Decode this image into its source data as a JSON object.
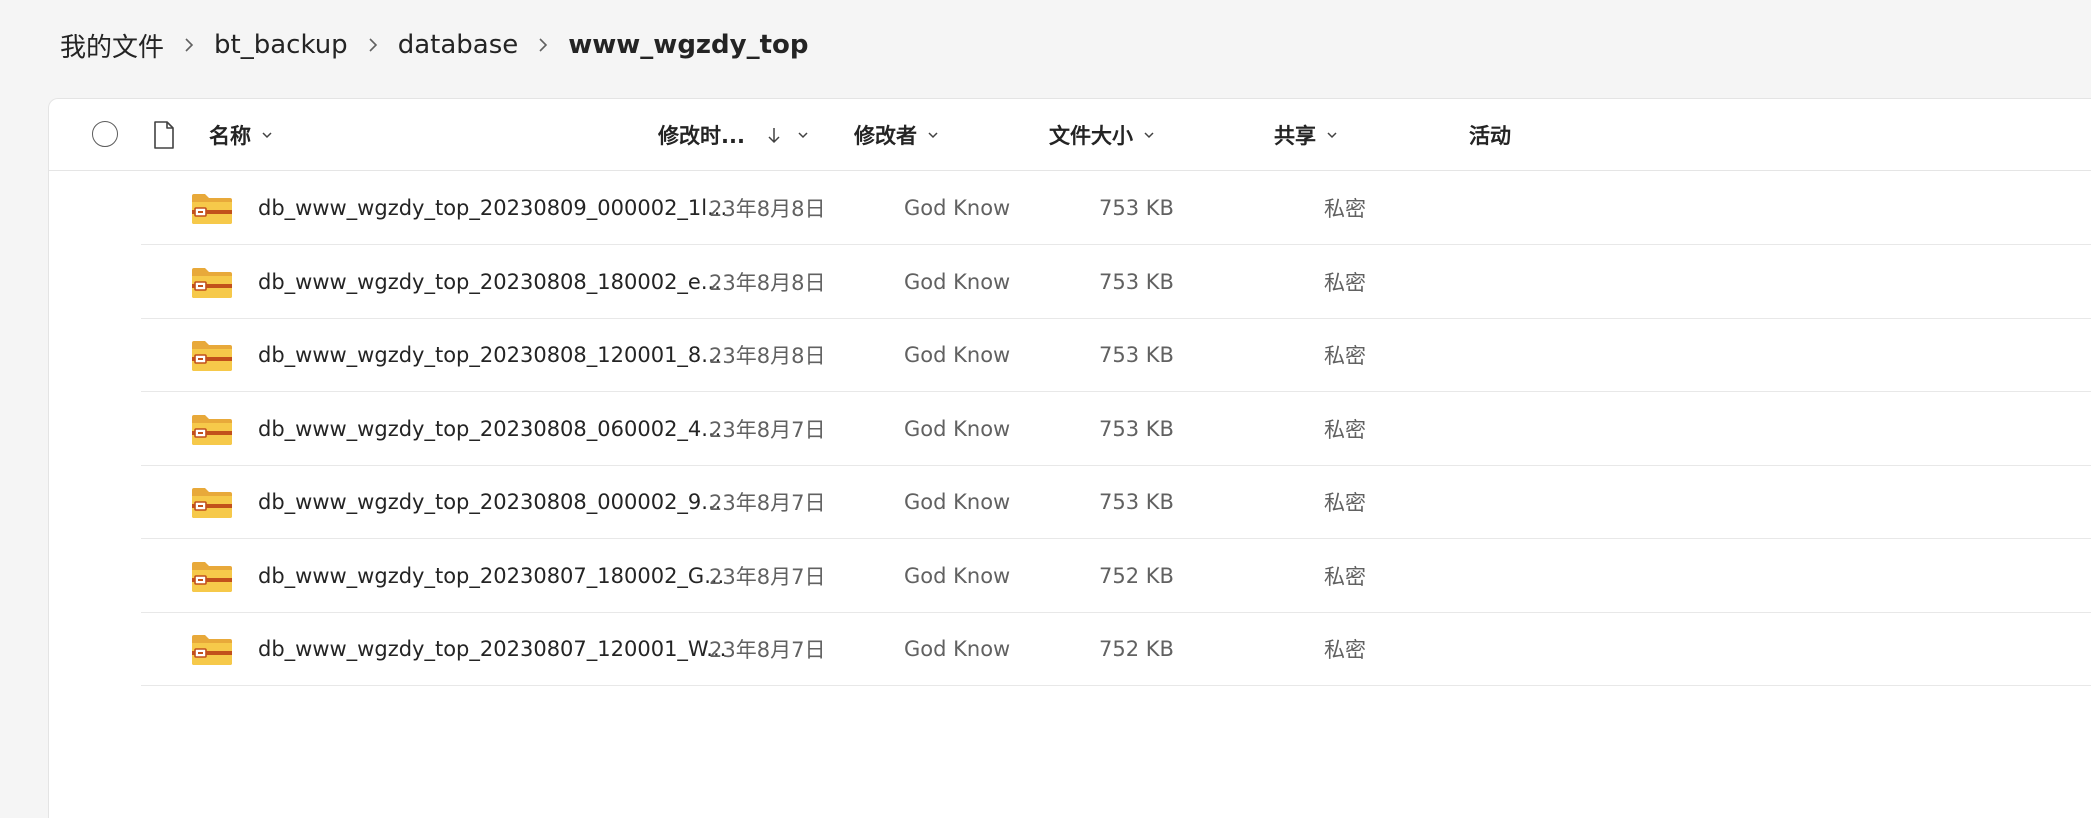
{
  "breadcrumb": [
    {
      "label": "我的文件",
      "current": false
    },
    {
      "label": "bt_backup",
      "current": false
    },
    {
      "label": "database",
      "current": false
    },
    {
      "label": "www_wgzdy_top",
      "current": true
    }
  ],
  "columns": {
    "name": "名称",
    "modified": "修改时...",
    "modified_by": "修改者",
    "size": "文件大小",
    "sharing": "共享",
    "activity": "活动"
  },
  "sort": {
    "column": "modified",
    "direction": "descending"
  },
  "files": [
    {
      "name": "db_www_wgzdy_top_20230809_000002_1l...",
      "modified": "23年8月8日",
      "modified_by": "God Know",
      "size": "753 KB",
      "sharing": "私密",
      "icon": "zip-folder-icon"
    },
    {
      "name": "db_www_wgzdy_top_20230808_180002_e...",
      "modified": "23年8月8日",
      "modified_by": "God Know",
      "size": "753 KB",
      "sharing": "私密",
      "icon": "zip-folder-icon"
    },
    {
      "name": "db_www_wgzdy_top_20230808_120001_8...",
      "modified": "23年8月8日",
      "modified_by": "God Know",
      "size": "753 KB",
      "sharing": "私密",
      "icon": "zip-folder-icon"
    },
    {
      "name": "db_www_wgzdy_top_20230808_060002_4...",
      "modified": "23年8月7日",
      "modified_by": "God Know",
      "size": "753 KB",
      "sharing": "私密",
      "icon": "zip-folder-icon"
    },
    {
      "name": "db_www_wgzdy_top_20230808_000002_9...",
      "modified": "23年8月7日",
      "modified_by": "God Know",
      "size": "753 KB",
      "sharing": "私密",
      "icon": "zip-folder-icon"
    },
    {
      "name": "db_www_wgzdy_top_20230807_180002_G...",
      "modified": "23年8月7日",
      "modified_by": "God Know",
      "size": "752 KB",
      "sharing": "私密",
      "icon": "zip-folder-icon"
    },
    {
      "name": "db_www_wgzdy_top_20230807_120001_W...",
      "modified": "23年8月7日",
      "modified_by": "God Know",
      "size": "752 KB",
      "sharing": "私密",
      "icon": "zip-folder-icon"
    }
  ],
  "colors": {
    "folder": "#f6c94a",
    "folder_dark": "#e8a93a",
    "zip_stripe": "#c2501b"
  }
}
